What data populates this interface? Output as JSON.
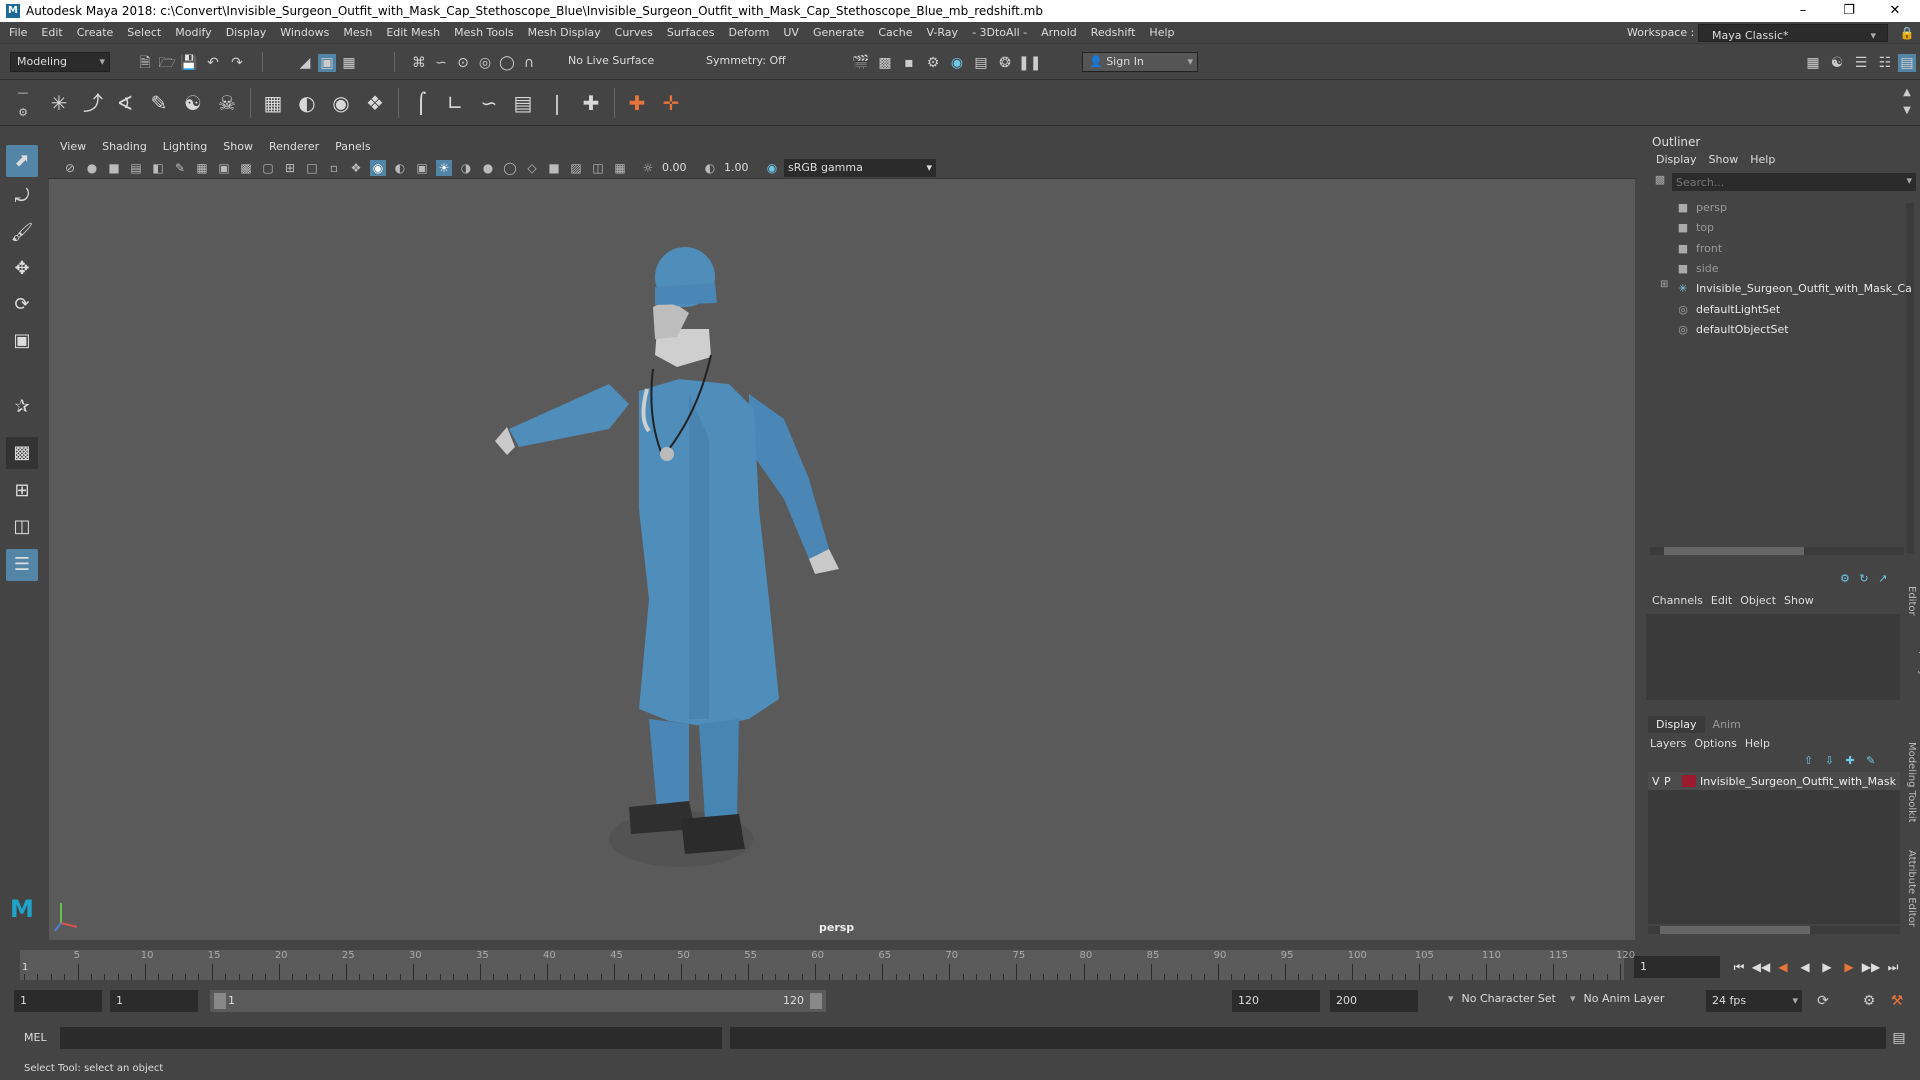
{
  "window": {
    "title": "Autodesk Maya 2018: c:\\Convert\\Invisible_Surgeon_Outfit_with_Mask_Cap_Stethoscope_Blue\\Invisible_Surgeon_Outfit_with_Mask_Cap_Stethoscope_Blue_mb_redshift.mb",
    "logo": "M"
  },
  "menubar": {
    "items": [
      "File",
      "Edit",
      "Create",
      "Select",
      "Modify",
      "Display",
      "Windows",
      "Mesh",
      "Edit Mesh",
      "Mesh Tools",
      "Mesh Display",
      "Curves",
      "Surfaces",
      "Deform",
      "UV",
      "Generate",
      "Cache",
      "V-Ray",
      "- 3DtoAll -",
      "Arnold",
      "Redshift",
      "Help"
    ],
    "workspace_label": "Workspace :",
    "workspace_value": "Maya Classic*"
  },
  "statusline": {
    "mode": "Modeling",
    "live_surface": "No Live Surface",
    "symmetry": "Symmetry: Off",
    "sign_in": "Sign In"
  },
  "viewport": {
    "menu": [
      "View",
      "Shading",
      "Lighting",
      "Show",
      "Renderer",
      "Panels"
    ],
    "exposure": "0.00",
    "gamma": "1.00",
    "color_space": "sRGB gamma",
    "camera_label": "persp"
  },
  "outliner": {
    "title": "Outliner",
    "menu": [
      "Display",
      "Show",
      "Help"
    ],
    "search_placeholder": "Search...",
    "items": [
      {
        "label": "persp",
        "icon": "camera-icon"
      },
      {
        "label": "top",
        "icon": "camera-icon"
      },
      {
        "label": "front",
        "icon": "camera-icon"
      },
      {
        "label": "side",
        "icon": "camera-icon"
      },
      {
        "label": "Invisible_Surgeon_Outfit_with_Mask_Ca",
        "icon": "transform-icon"
      },
      {
        "label": "defaultLightSet",
        "icon": "set-icon"
      },
      {
        "label": "defaultObjectSet",
        "icon": "set-icon"
      }
    ]
  },
  "channel_box": {
    "menu": [
      "Channels",
      "Edit",
      "Object",
      "Show"
    ]
  },
  "layer_editor": {
    "tabs": [
      "Display",
      "Anim"
    ],
    "menu": [
      "Layers",
      "Options",
      "Help"
    ],
    "layer": {
      "v": "V",
      "p": "P",
      "name": "Invisible_Surgeon_Outfit_with_Mask",
      "color": "#9a1b2e"
    }
  },
  "side_tabs": [
    "Channel Box / Layer Editor",
    "Modeling Toolkit",
    "Attribute Editor"
  ],
  "timeline": {
    "ticks": [
      "5",
      "10",
      "15",
      "20",
      "25",
      "30",
      "35",
      "40",
      "45",
      "50",
      "55",
      "60",
      "65",
      "70",
      "75",
      "80",
      "85",
      "90",
      "95",
      "100",
      "105",
      "110",
      "115",
      "120"
    ],
    "start_marker": "1",
    "current_frame": "1"
  },
  "range": {
    "start": "1",
    "playback_start": "1",
    "slider_start": "1",
    "slider_end": "120",
    "playback_end": "120",
    "end": "200",
    "character_set": "No Character Set",
    "anim_layer": "No Anim Layer",
    "fps": "24 fps"
  },
  "command": {
    "label": "MEL"
  },
  "status": {
    "help_line": "Select Tool: select an object"
  },
  "colors": {
    "accent": "#5285a6",
    "outfit": "#4f8dbb"
  }
}
